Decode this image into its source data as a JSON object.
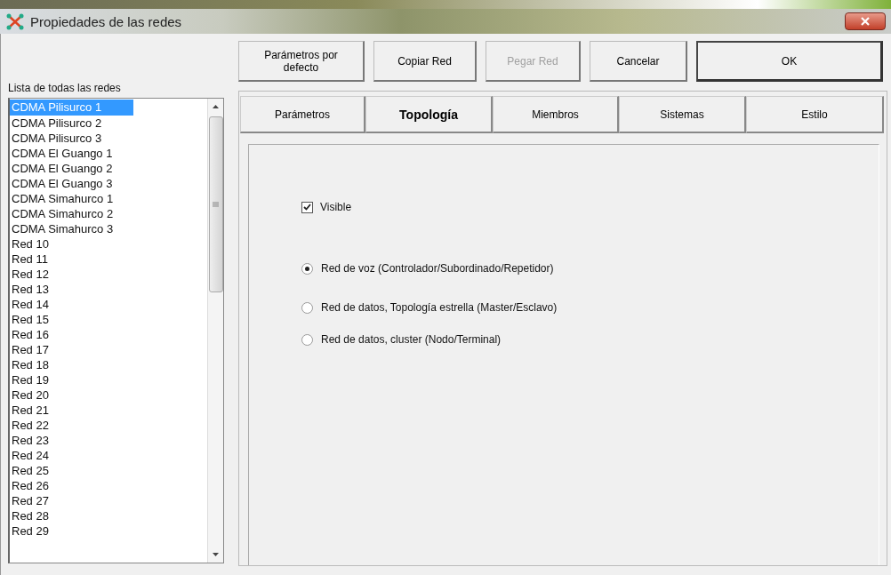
{
  "window": {
    "title": "Propiedades de las redes"
  },
  "network_list": {
    "label": "Lista de todas las redes",
    "items": [
      {
        "label": "CDMA Pilisurco 1",
        "selected": true
      },
      {
        "label": "CDMA Pilisurco 2",
        "selected": false
      },
      {
        "label": "CDMA Pilisurco 3",
        "selected": false
      },
      {
        "label": "CDMA El Guango 1",
        "selected": false
      },
      {
        "label": "CDMA El Guango 2",
        "selected": false
      },
      {
        "label": "CDMA El Guango 3",
        "selected": false
      },
      {
        "label": "CDMA Simahurco 1",
        "selected": false
      },
      {
        "label": "CDMA Simahurco 2",
        "selected": false
      },
      {
        "label": "CDMA Simahurco 3",
        "selected": false
      },
      {
        "label": "Red 10",
        "selected": false
      },
      {
        "label": "Red 11",
        "selected": false
      },
      {
        "label": "Red 12",
        "selected": false
      },
      {
        "label": "Red 13",
        "selected": false
      },
      {
        "label": "Red 14",
        "selected": false
      },
      {
        "label": "Red 15",
        "selected": false
      },
      {
        "label": "Red 16",
        "selected": false
      },
      {
        "label": "Red 17",
        "selected": false
      },
      {
        "label": "Red 18",
        "selected": false
      },
      {
        "label": "Red 19",
        "selected": false
      },
      {
        "label": "Red 20",
        "selected": false
      },
      {
        "label": "Red 21",
        "selected": false
      },
      {
        "label": "Red 22",
        "selected": false
      },
      {
        "label": "Red 23",
        "selected": false
      },
      {
        "label": "Red 24",
        "selected": false
      },
      {
        "label": "Red 25",
        "selected": false
      },
      {
        "label": "Red 26",
        "selected": false
      },
      {
        "label": "Red 27",
        "selected": false
      },
      {
        "label": "Red 28",
        "selected": false
      },
      {
        "label": "Red 29",
        "selected": false
      }
    ]
  },
  "buttons": [
    {
      "label": "Parámetros por defecto",
      "disabled": false,
      "default": false
    },
    {
      "label": "Copiar Red",
      "disabled": false,
      "default": false
    },
    {
      "label": "Pegar Red",
      "disabled": true,
      "default": false
    },
    {
      "label": "Cancelar",
      "disabled": false,
      "default": false
    },
    {
      "label": "OK",
      "disabled": false,
      "default": true
    }
  ],
  "tabs": [
    {
      "label": "Parámetros",
      "selected": false
    },
    {
      "label": "Topología",
      "selected": true
    },
    {
      "label": "Miembros",
      "selected": false
    },
    {
      "label": "Sistemas",
      "selected": false
    },
    {
      "label": "Estilo",
      "selected": false
    }
  ],
  "topology": {
    "visible": {
      "label": "Visible",
      "checked": true
    },
    "network_types": [
      {
        "label": "Red de voz (Controlador/Subordinado/Repetidor)",
        "selected": true
      },
      {
        "label": "Red de datos, Topología estrella (Master/Esclavo)",
        "selected": false
      },
      {
        "label": "Red de datos, cluster (Nodo/Terminal)",
        "selected": false
      }
    ]
  }
}
